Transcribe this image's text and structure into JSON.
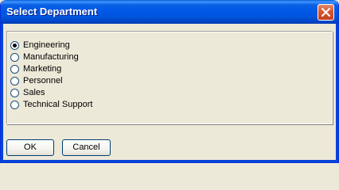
{
  "window": {
    "title": "Select Department"
  },
  "icons": {
    "close": "close-icon"
  },
  "colors": {
    "titlebar": "#0058e6",
    "close_button": "#d5572f",
    "window_background": "#ece9d8"
  },
  "departments": {
    "selected": "Engineering",
    "options": [
      "Engineering",
      "Manufacturing",
      "Marketing",
      "Personnel",
      "Sales",
      "Technical Support"
    ]
  },
  "buttons": {
    "ok": "OK",
    "cancel": "Cancel"
  }
}
